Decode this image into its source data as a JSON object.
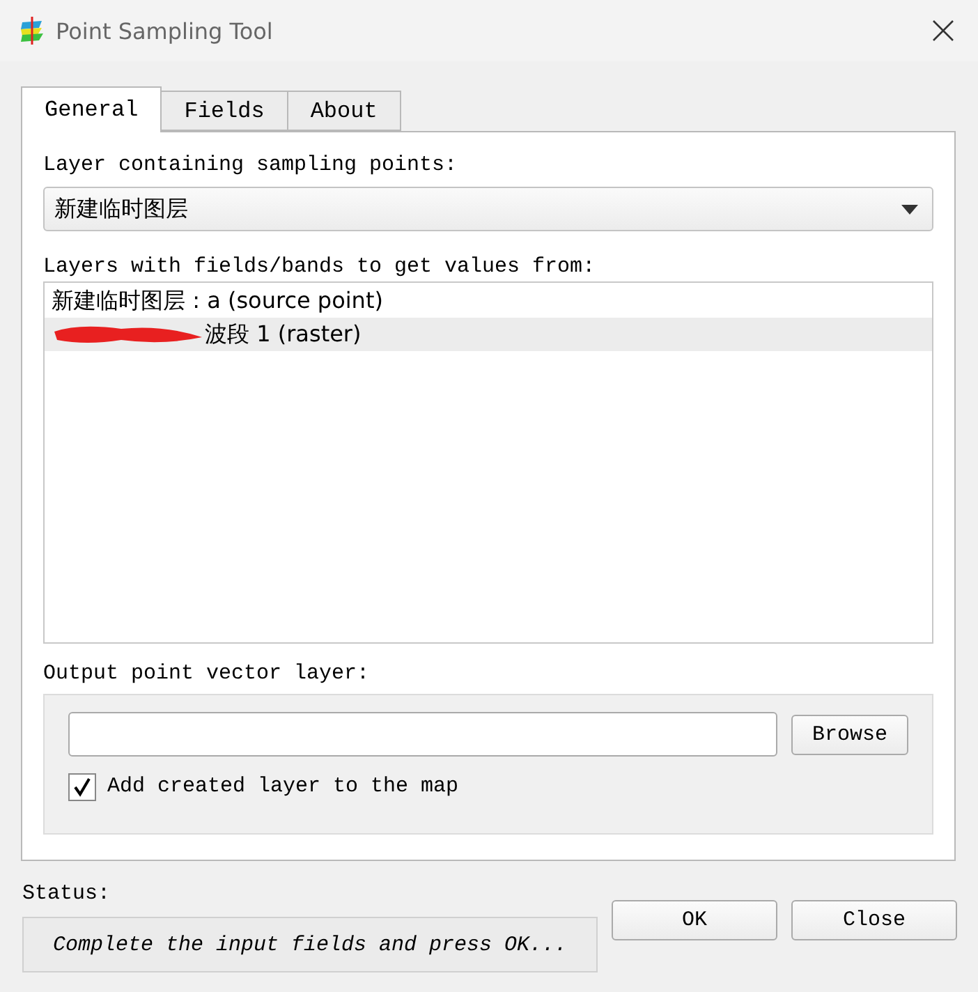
{
  "window": {
    "title": "Point Sampling Tool"
  },
  "tabs": [
    {
      "label": "General",
      "selected": true
    },
    {
      "label": "Fields",
      "selected": false
    },
    {
      "label": "About",
      "selected": false
    }
  ],
  "source_layer": {
    "label": "Layer containing sampling points:",
    "value": "新建临时图层"
  },
  "value_layers": {
    "label": "Layers with fields/bands to get values from:",
    "items": [
      {
        "text": "新建临时图层 : a (source point)",
        "selected": false,
        "redacted": false
      },
      {
        "text": "波段 1 (raster)",
        "selected": true,
        "redacted": true
      }
    ]
  },
  "output": {
    "label": "Output point vector layer:",
    "browse": "Browse",
    "add_to_map": {
      "label": "Add created layer to the map",
      "checked": true
    }
  },
  "status": {
    "label": "Status:",
    "message": "Complete the input fields and press OK..."
  },
  "buttons": [
    "OK",
    "Close"
  ]
}
